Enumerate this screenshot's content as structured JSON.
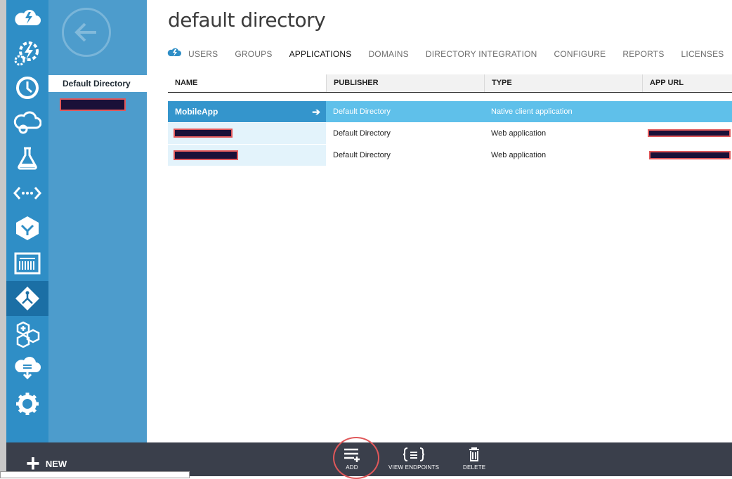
{
  "page": {
    "title": "default directory"
  },
  "icon_rail": {
    "items": [
      {
        "icon": "all-items-cloud-icon"
      },
      {
        "icon": "web-sites-icon"
      },
      {
        "icon": "mobile-services-icon"
      },
      {
        "icon": "cloud-services-icon"
      },
      {
        "icon": "hdinsight-flask-icon"
      },
      {
        "icon": "media-services-icon"
      },
      {
        "icon": "service-bus-icon"
      },
      {
        "icon": "storage-icon"
      },
      {
        "icon": "active-directory-icon"
      },
      {
        "icon": "add-ons-icon"
      },
      {
        "icon": "cloud-download-icon"
      },
      {
        "icon": "settings-gear-icon"
      }
    ],
    "active_index": 8
  },
  "subnav": {
    "back_icon": "back-arrow-icon",
    "active_item": "Default Directory"
  },
  "tabs": [
    {
      "label": "USERS",
      "active": false
    },
    {
      "label": "GROUPS",
      "active": false
    },
    {
      "label": "APPLICATIONS",
      "active": true
    },
    {
      "label": "DOMAINS",
      "active": false
    },
    {
      "label": "DIRECTORY INTEGRATION",
      "active": false
    },
    {
      "label": "CONFIGURE",
      "active": false
    },
    {
      "label": "REPORTS",
      "active": false
    },
    {
      "label": "LICENSES",
      "active": false
    }
  ],
  "table": {
    "columns": [
      "NAME",
      "PUBLISHER",
      "TYPE",
      "APP URL"
    ],
    "rows": [
      {
        "name": "MobileApp",
        "publisher": "Default Directory",
        "type": "Native client application",
        "app_url": "",
        "selected": true
      },
      {
        "name": "",
        "publisher": "Default Directory",
        "type": "Web application",
        "app_url": "",
        "selected": false
      },
      {
        "name": "",
        "publisher": "Default Directory",
        "type": "Web application",
        "app_url": "",
        "selected": false
      }
    ]
  },
  "commands": {
    "new_label": "NEW",
    "add_label": "ADD",
    "view_endpoints_label": "VIEW ENDPOINTS",
    "delete_label": "DELETE"
  },
  "colors": {
    "rail": "#2f8ec6",
    "subnav": "#4d9ccc",
    "selected_row": "#5fc0ea",
    "selected_name": "#3495cc",
    "bottom_bar": "#3a3f4b",
    "highlight_ring": "#e0585a"
  }
}
